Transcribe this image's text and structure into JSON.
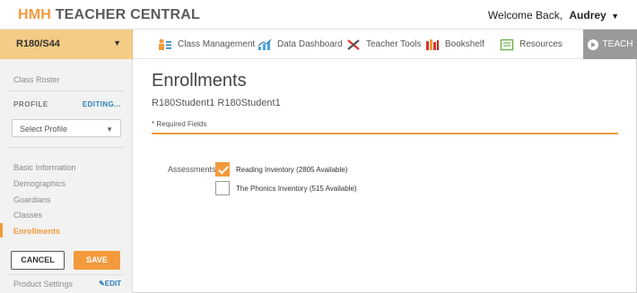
{
  "header": {
    "logo_hmh": "HMH",
    "logo_rest": "TEACHER CENTRAL",
    "welcome": "Welcome Back,",
    "user": "Audrey"
  },
  "nav": {
    "class_selector": "R180/S44",
    "items": [
      {
        "label": "Class Management",
        "icon": "class-management-icon"
      },
      {
        "label": "Data Dashboard",
        "icon": "chart-icon"
      },
      {
        "label": "Teacher Tools",
        "icon": "tools-icon"
      },
      {
        "label": "Bookshelf",
        "icon": "books-icon"
      },
      {
        "label": "Resources",
        "icon": "resources-icon"
      }
    ],
    "teach": "TEACH"
  },
  "sidebar": {
    "class_roster": "Class Roster",
    "profile": "PROFILE",
    "editing": "EDITING...",
    "select_profile": "Select Profile",
    "links": [
      "Basic Information",
      "Demographics",
      "Guardians",
      "Classes"
    ],
    "active": "Enrollments",
    "cancel": "CANCEL",
    "save": "SAVE",
    "product_settings": "Product Settings",
    "edit": "EDIT"
  },
  "main": {
    "title": "Enrollments",
    "student": "R180Student1 R180Student1",
    "required": "* Required Fields",
    "assessments_label": "Assessments",
    "options": [
      {
        "label": "Reading Inventory (2805 Available)",
        "checked": true
      },
      {
        "label": "The Phonics Inventory (515 Available)",
        "checked": false
      }
    ]
  },
  "colors": {
    "accent": "#f39a3c",
    "class_selector_bg": "#f3cc85",
    "link_blue": "#2c7fb8",
    "teach_bg": "#9a9a9a"
  }
}
